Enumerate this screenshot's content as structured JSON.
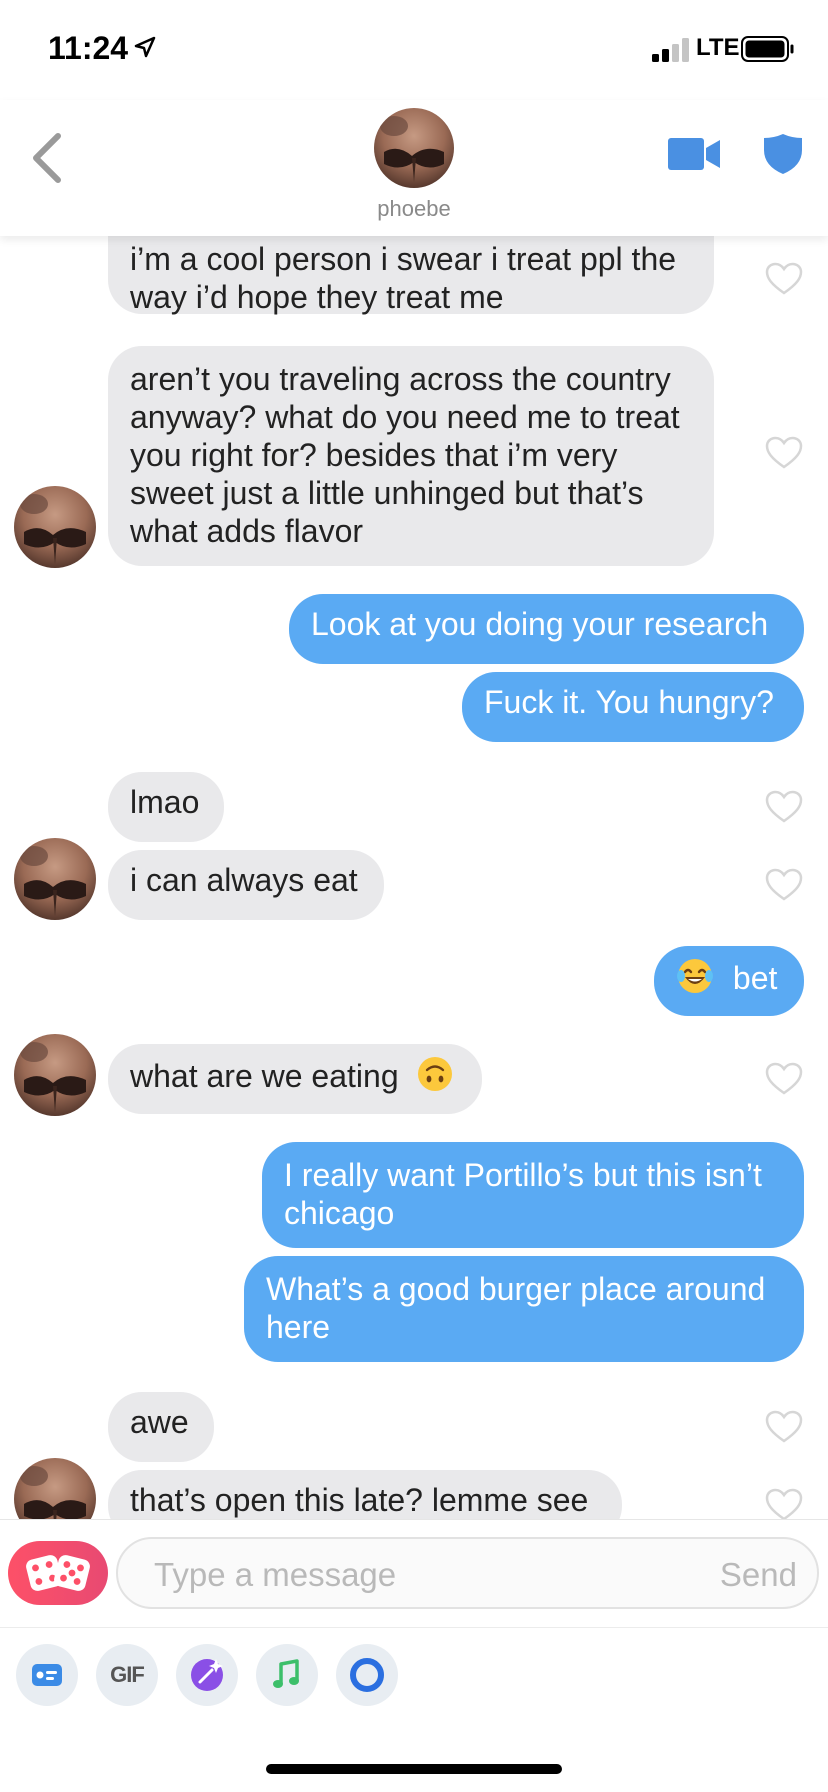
{
  "status_bar": {
    "time": "11:24",
    "network": "LTE"
  },
  "header": {
    "contact_name": "phoebe"
  },
  "colors": {
    "incoming_bubble": "#e9e9eb",
    "outgoing_bubble": "#5aaaf3",
    "brand": "#fd5068",
    "header_icons": "#4a90e2"
  },
  "messages": [
    {
      "direction": "in",
      "text": "i’m a cool person i swear i treat ppl the way i’d hope they treat me"
    },
    {
      "direction": "in",
      "text": "aren’t you traveling across the country anyway? what do you need me to treat you right for? besides that i’m very sweet just a little unhinged but that’s what adds flavor"
    },
    {
      "direction": "out",
      "text": "Look at you doing your research"
    },
    {
      "direction": "out",
      "text": "Fuck it. You hungry?"
    },
    {
      "direction": "in",
      "text": "lmao"
    },
    {
      "direction": "in",
      "text": "i can always eat"
    },
    {
      "direction": "out",
      "text": "bet",
      "emoji": "tears-of-joy-emoji"
    },
    {
      "direction": "in",
      "text": "what are we eating",
      "emoji": "upside-down-face-emoji"
    },
    {
      "direction": "out",
      "text": "I really want Portillo’s but this isn’t chicago"
    },
    {
      "direction": "out",
      "text": "What’s a good burger place around here"
    },
    {
      "direction": "in",
      "text": "awe"
    },
    {
      "direction": "in",
      "text": "that’s open this late? lemme see"
    }
  ],
  "composer": {
    "placeholder": "Type a message",
    "send_label": "Send"
  },
  "toolbar": {
    "gif_label": "GIF",
    "icons": [
      "card-icon",
      "gif-icon",
      "sticker-icon",
      "music-icon",
      "loop-icon"
    ]
  }
}
